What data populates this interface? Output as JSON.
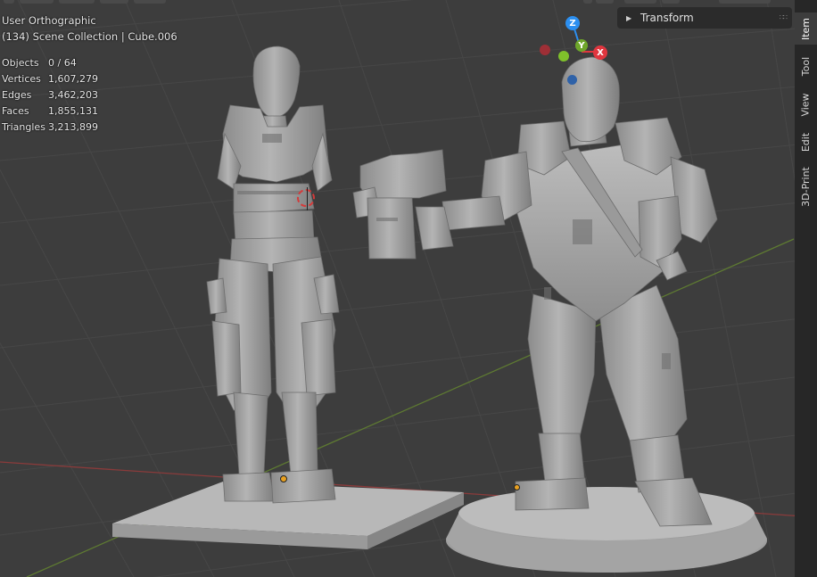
{
  "viewport": {
    "view_name": "User Orthographic",
    "scene_info": "(134) Scene Collection | Cube.006"
  },
  "stats": [
    {
      "label": "Objects",
      "value": "0 / 64"
    },
    {
      "label": "Vertices",
      "value": "1,607,279"
    },
    {
      "label": "Edges",
      "value": "3,462,203"
    },
    {
      "label": "Faces",
      "value": "1,855,131"
    },
    {
      "label": "Triangles",
      "value": "3,213,899"
    }
  ],
  "transform_panel": {
    "label": "Transform"
  },
  "sidebar_tabs": [
    {
      "label": "Item",
      "active": true
    },
    {
      "label": "Tool",
      "active": false
    },
    {
      "label": "View",
      "active": false
    },
    {
      "label": "Edit",
      "active": false
    },
    {
      "label": "3D-Print",
      "active": false
    }
  ],
  "gizmo": {
    "z_label": "Z",
    "y_label": "Y",
    "x_label": "X",
    "colors": {
      "x": "#e0363f",
      "y": "#6ea62a",
      "z": "#2c8ff0"
    }
  },
  "colors": {
    "background": "#3d3d3d",
    "grid": "#474747",
    "x_axis": "#8a3b3b",
    "y_axis": "#5e7a32",
    "model": "#a8a8a8"
  }
}
